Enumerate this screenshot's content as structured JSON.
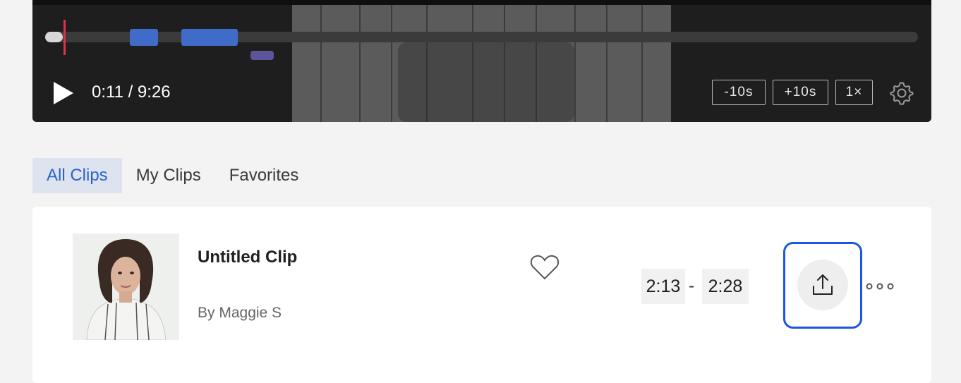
{
  "player": {
    "time_readout": "0:11 / 9:26",
    "progress_fraction": 0.02,
    "controls": {
      "back10": "-10s",
      "fwd10": "+10s",
      "speed": "1×"
    },
    "icons": {
      "play": "play-icon",
      "settings": "gear-icon"
    },
    "colors": {
      "playhead": "#e0314b",
      "clip_marker": "#3f6bc9",
      "clip_marker_alt": "#5d559b"
    }
  },
  "tabs": [
    {
      "label": "All Clips",
      "active": true
    },
    {
      "label": "My Clips",
      "active": false
    },
    {
      "label": "Favorites",
      "active": false
    }
  ],
  "clip": {
    "title": "Untitled Clip",
    "author": "By Maggie S",
    "start": "2:13",
    "separator": "-",
    "end": "2:28",
    "icons": {
      "favorite": "heart-icon",
      "share": "share-icon",
      "more": "more-icon"
    },
    "highlight_color": "#1a56e8"
  }
}
